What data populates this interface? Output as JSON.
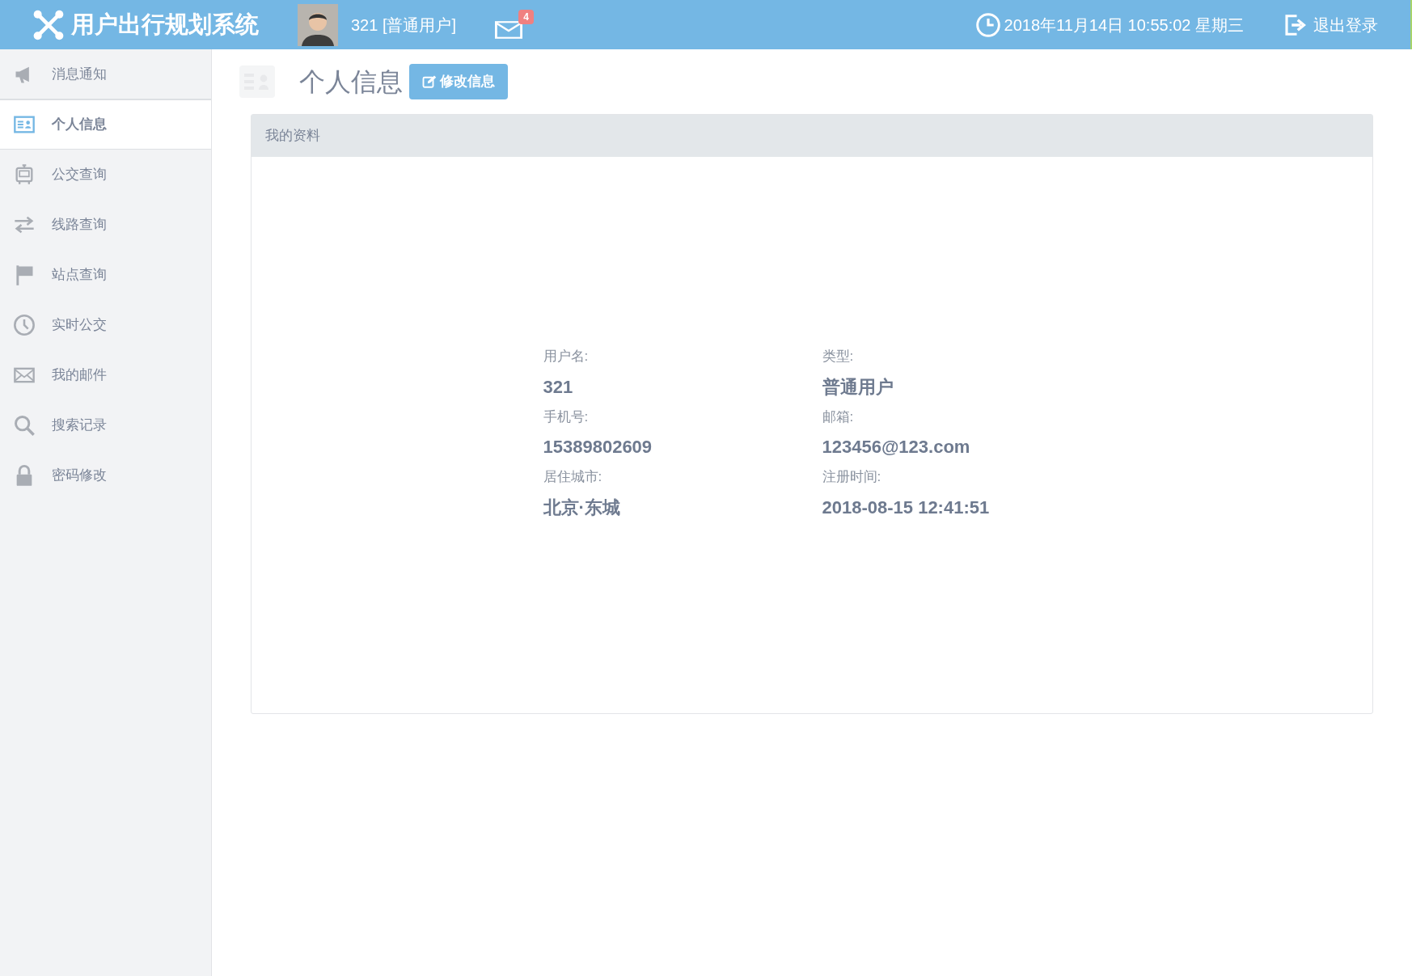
{
  "header": {
    "title": "用户出行规划系统",
    "user": "321 [普通用户]",
    "mail_count": "4",
    "datetime": "2018年11月14日 10:55:02 星期三",
    "logout": "退出登录"
  },
  "sidebar": {
    "items": [
      {
        "label": "消息通知",
        "selected": false
      },
      {
        "label": "个人信息",
        "selected": true
      },
      {
        "label": "公交查询",
        "selected": false
      },
      {
        "label": "线路查询",
        "selected": false
      },
      {
        "label": "站点查询",
        "selected": false
      },
      {
        "label": "实时公交",
        "selected": false
      },
      {
        "label": "我的邮件",
        "selected": false
      },
      {
        "label": "搜索记录",
        "selected": false
      },
      {
        "label": "密码修改",
        "selected": false
      }
    ]
  },
  "page": {
    "title": "个人信息",
    "edit_button": "修改信息"
  },
  "profile_card": {
    "title": "我的资料",
    "fields": [
      {
        "label": "用户名:",
        "value": "321"
      },
      {
        "label": "类型:",
        "value": "普通用户"
      },
      {
        "label": "手机号:",
        "value": "15389802609"
      },
      {
        "label": "邮箱:",
        "value": "123456@123.com"
      },
      {
        "label": "居住城市:",
        "value": "北京·东城"
      },
      {
        "label": "注册时间:",
        "value": "2018-08-15 12:41:51"
      }
    ]
  }
}
